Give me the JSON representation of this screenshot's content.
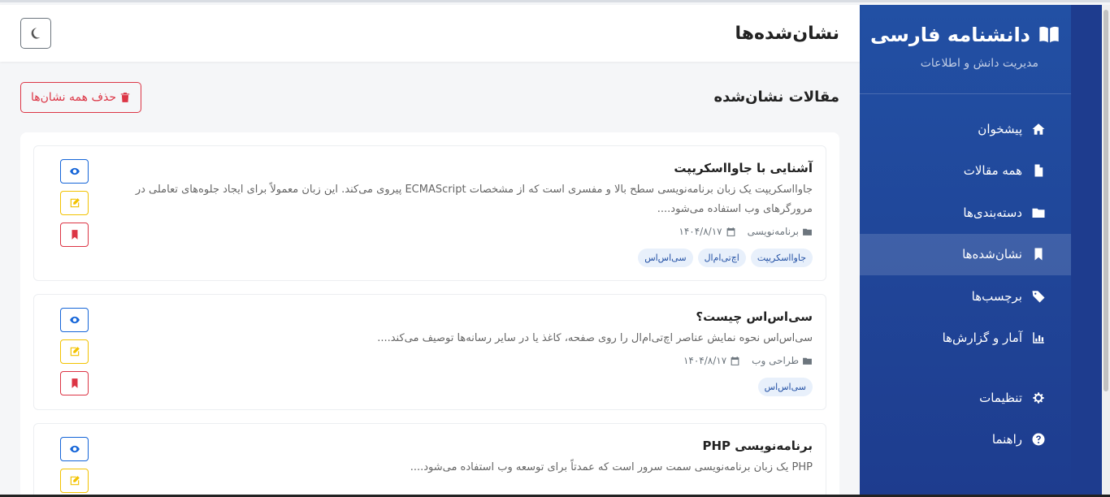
{
  "app": {
    "brand": "دانشنامه فارسی",
    "subtitle": "مدیریت دانش و اطلاعات"
  },
  "sidebar": {
    "items": [
      {
        "label": "پیشخوان",
        "icon": "home-icon",
        "active": false
      },
      {
        "label": "همه مقالات",
        "icon": "file-icon",
        "active": false
      },
      {
        "label": "دسته‌بندی‌ها",
        "icon": "folder-icon",
        "active": false
      },
      {
        "label": "نشان‌شده‌ها",
        "icon": "bookmark-icon",
        "active": true
      },
      {
        "label": "برچسب‌ها",
        "icon": "tags-icon",
        "active": false
      },
      {
        "label": "آمار و گزارش‌ها",
        "icon": "chart-icon",
        "active": false
      }
    ],
    "footer_items": [
      {
        "label": "تنظیمات",
        "icon": "gear-icon"
      },
      {
        "label": "راهنما",
        "icon": "help-icon"
      }
    ]
  },
  "header": {
    "title": "نشان‌شده‌ها"
  },
  "section": {
    "title": "مقالات نشان‌شده",
    "delete_all_label": "حذف همه نشان‌ها"
  },
  "articles": [
    {
      "title": "آشنایی با جاوااسکریپت",
      "excerpt": "جاوااسکریپت یک زبان برنامه‌نویسی سطح بالا و مفسری است که از مشخصات ECMAScript پیروی می‌کند. این زبان معمولاً برای ایجاد جلوه‌های تعاملی در مرورگرهای وب استفاده می‌شود....",
      "category": "برنامه‌نویسی",
      "date": "۱۴۰۴/۸/۱۷",
      "tags": [
        "جاوااسکریپت",
        "اچ‌تی‌ام‌ال",
        "سی‌اس‌اس"
      ]
    },
    {
      "title": "سی‌اس‌اس چیست؟",
      "excerpt": "سی‌اس‌اس نحوه نمایش عناصر اچ‌تی‌ام‌ال را روی صفحه، کاغذ یا در سایر رسانه‌ها توصیف می‌کند....",
      "category": "طراحی وب",
      "date": "۱۴۰۴/۸/۱۷",
      "tags": [
        "سی‌اس‌اس"
      ]
    },
    {
      "title": "برنامه‌نویسی PHP",
      "excerpt": "PHP یک زبان برنامه‌نویسی سمت سرور است که عمدتاً برای توسعه وب استفاده می‌شود....",
      "category": "",
      "date": "",
      "tags": []
    }
  ]
}
